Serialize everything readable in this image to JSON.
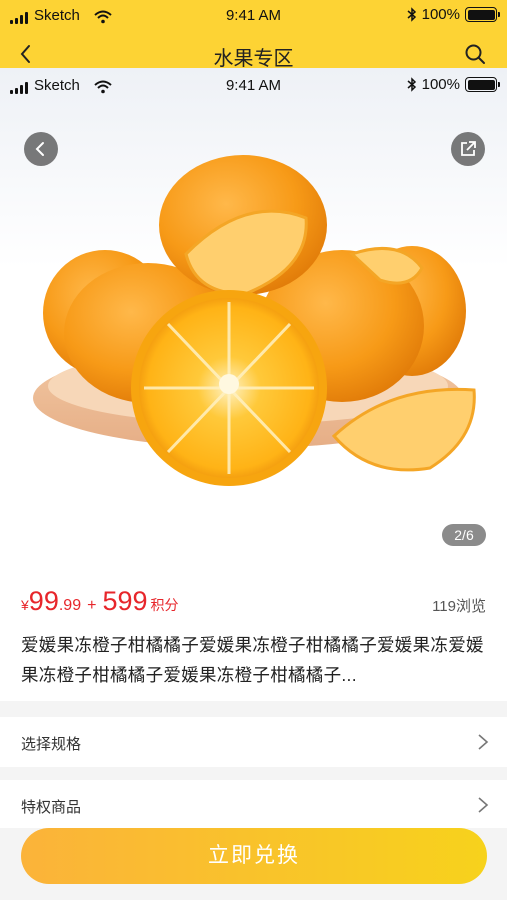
{
  "status_bar": {
    "carrier": "Sketch",
    "time": "9:41 AM",
    "battery": "100%"
  },
  "nav": {
    "title": "水果专区"
  },
  "gallery": {
    "page_indicator": "2/6"
  },
  "product": {
    "currency": "¥",
    "price_int": "99",
    "price_dec": ".99",
    "plus": "+",
    "points": "599",
    "points_unit": "积分",
    "views": "119浏览",
    "description": "爱媛果冻橙子柑橘橘子爱媛果冻橙子柑橘橘子爱媛果冻爱媛果冻橙子柑橘橘子爱媛果冻橙子柑橘橘子..."
  },
  "options": [
    {
      "label": "选择规格"
    },
    {
      "label": "特权商品"
    }
  ],
  "cta": {
    "label": "立即兑换"
  },
  "colors": {
    "header_yellow": "#fdd334",
    "price_red": "#e7262b",
    "cta_start": "#fbb33a",
    "cta_end": "#f7d21c"
  },
  "icons": [
    "back-chevron-icon",
    "search-icon",
    "share-icon",
    "chevron-right-icon",
    "wifi-icon",
    "bluetooth-icon",
    "battery-icon",
    "signal-icon"
  ]
}
